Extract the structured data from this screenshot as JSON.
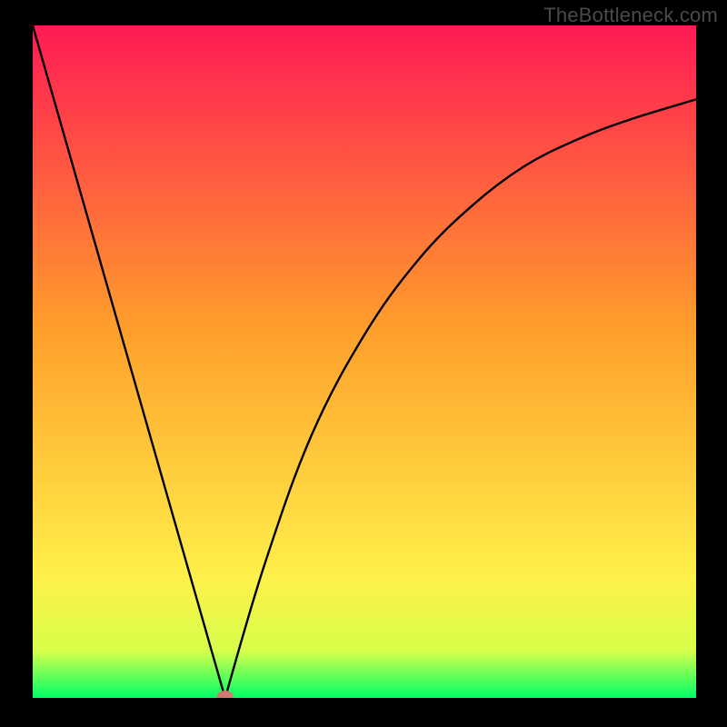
{
  "watermark": "TheBottleneck.com",
  "chart_data": {
    "type": "line",
    "title": "",
    "xlabel": "",
    "ylabel": "",
    "xlim": [
      0,
      100
    ],
    "ylim": [
      0,
      100
    ],
    "grid": false,
    "legend": false,
    "background_gradient": {
      "top": "#ff1a55",
      "mid_upper": "#ff9e2b",
      "mid_lower": "#fff04a",
      "bottom": "#00ff66"
    },
    "series": [
      {
        "name": "bottleneck-curve",
        "segments": [
          {
            "type": "line",
            "x": [
              0,
              29
            ],
            "y": [
              100,
              0
            ]
          },
          {
            "type": "curve",
            "x": [
              29,
              35,
              42,
              50,
              58,
              66,
              74,
              82,
              90,
              100
            ],
            "y": [
              0,
              20,
              39,
              54,
              65,
              73,
              79,
              83,
              86,
              89
            ]
          }
        ],
        "color": "#000000"
      }
    ],
    "markers": [
      {
        "name": "optimum-marker",
        "x": 29,
        "y": 0,
        "color": "#cf7a6f",
        "shape": "ellipse"
      }
    ]
  }
}
